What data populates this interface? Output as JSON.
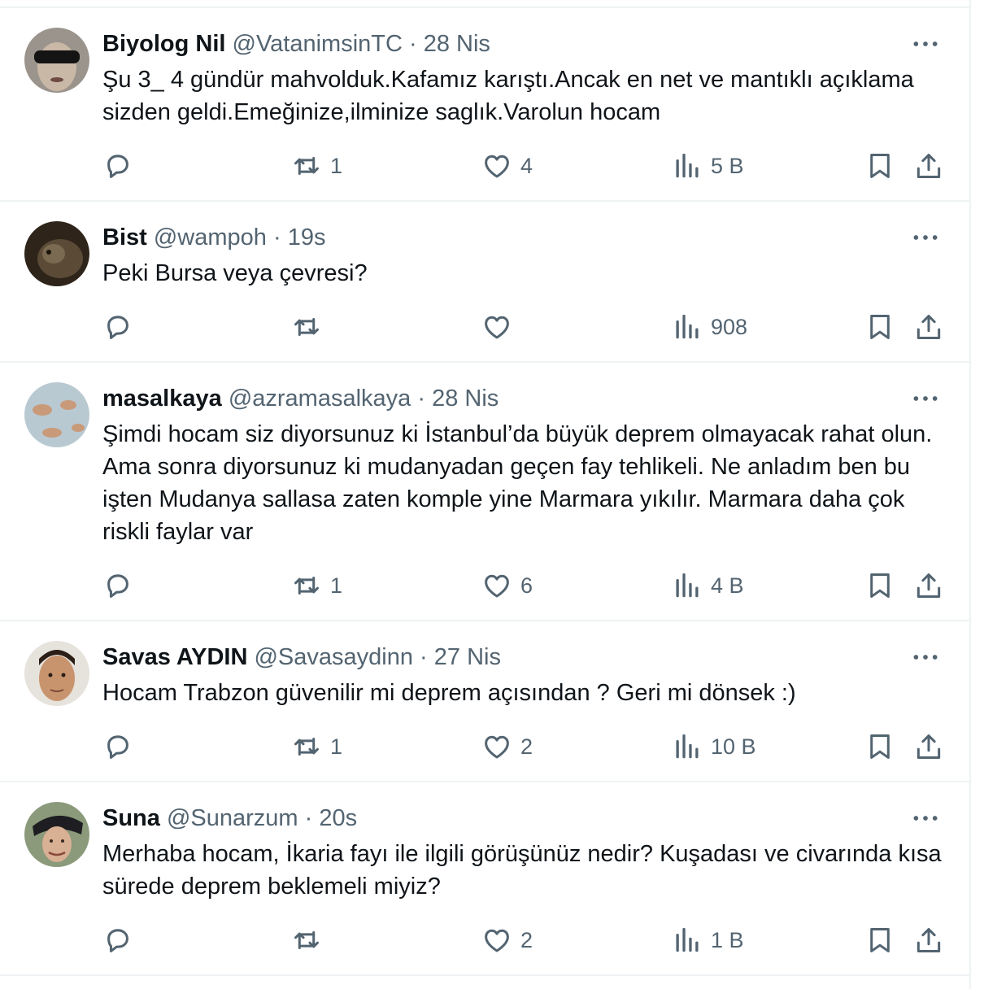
{
  "tweets": [
    {
      "name": "Biyolog Nil",
      "handle": "@VatanimsinTC",
      "sep": "·",
      "time": "28 Nis",
      "text": "Şu 3_ 4 gündür mahvolduk.Kafamız karıştı.Ancak en net ve mantıklı açıklama sizden geldi.Emeğinize,ilminize saglık.Varolun hocam",
      "replies": "",
      "retweets": "1",
      "likes": "4",
      "views": "5 B"
    },
    {
      "name": "Bist",
      "handle": "@wampoh",
      "sep": "·",
      "time": "19s",
      "text": "Peki Bursa veya çevresi?",
      "replies": "",
      "retweets": "",
      "likes": "",
      "views": "908"
    },
    {
      "name": "masalkaya",
      "handle": "@azramasalkaya",
      "sep": "·",
      "time": "28 Nis",
      "text": "Şimdi hocam siz diyorsunuz ki İstanbul’da büyük deprem olmayacak rahat olun. Ama sonra diyorsunuz ki mudanyadan geçen fay tehlikeli. Ne anladım ben bu işten Mudanya sallasa zaten komple yine Marmara yıkılır. Marmara daha çok  riskli faylar var",
      "replies": "",
      "retweets": "1",
      "likes": "6",
      "views": "4 B"
    },
    {
      "name": "Savas AYDIN",
      "handle": "@Savasaydinn",
      "sep": "·",
      "time": "27 Nis",
      "text": "Hocam Trabzon güvenilir mi deprem açısından ? Geri mi dönsek :)",
      "replies": "",
      "retweets": "1",
      "likes": "2",
      "views": "10 B"
    },
    {
      "name": "Suna",
      "handle": "@Sunarzum",
      "sep": "·",
      "time": "20s",
      "text": "Merhaba hocam, İkaria fayı ile ilgili görüşünüz nedir? Kuşadası ve civarında kısa sürede deprem beklemeli miyiz?",
      "replies": "",
      "retweets": "",
      "likes": "2",
      "views": "1 B"
    }
  ],
  "icons": {
    "reply": "reply-icon",
    "retweet": "retweet-icon",
    "like": "heart-icon",
    "views": "views-icon",
    "bookmark": "bookmark-icon",
    "share": "share-icon",
    "more": "more-icon"
  },
  "colors": {
    "text": "#0f1419",
    "secondary": "#536471",
    "divider": "#eff3f4"
  }
}
